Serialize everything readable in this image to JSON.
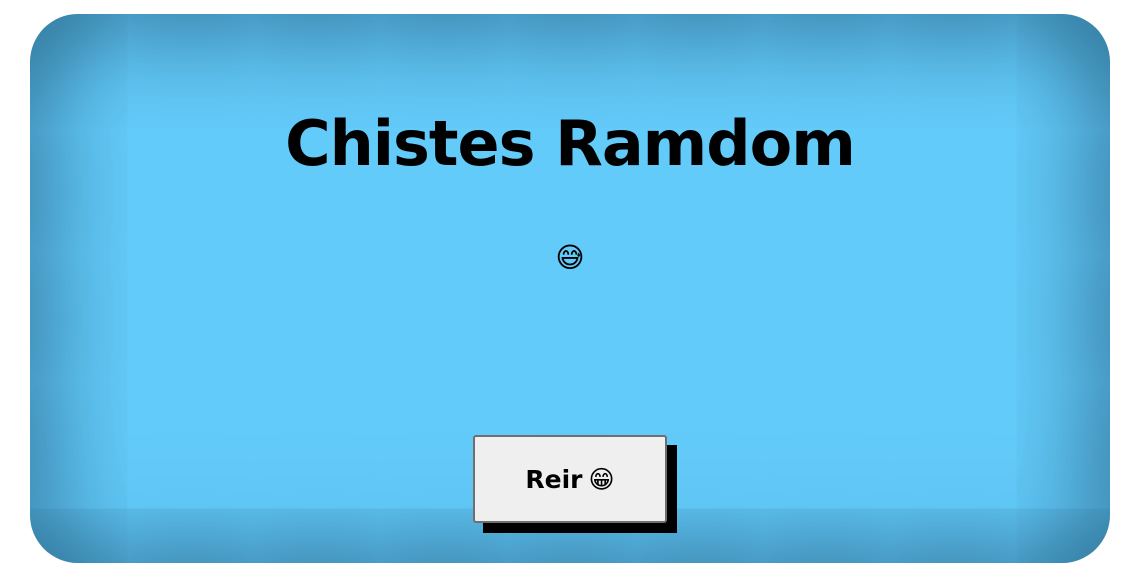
{
  "page": {
    "title": "Chistes Ramdom",
    "joke_text": "😅"
  },
  "button": {
    "label": "Reir",
    "emoji": "😁"
  },
  "colors": {
    "card_background": "#63cbfa",
    "text": "#000000",
    "button_background": "#efefef",
    "button_shadow": "#000000"
  }
}
